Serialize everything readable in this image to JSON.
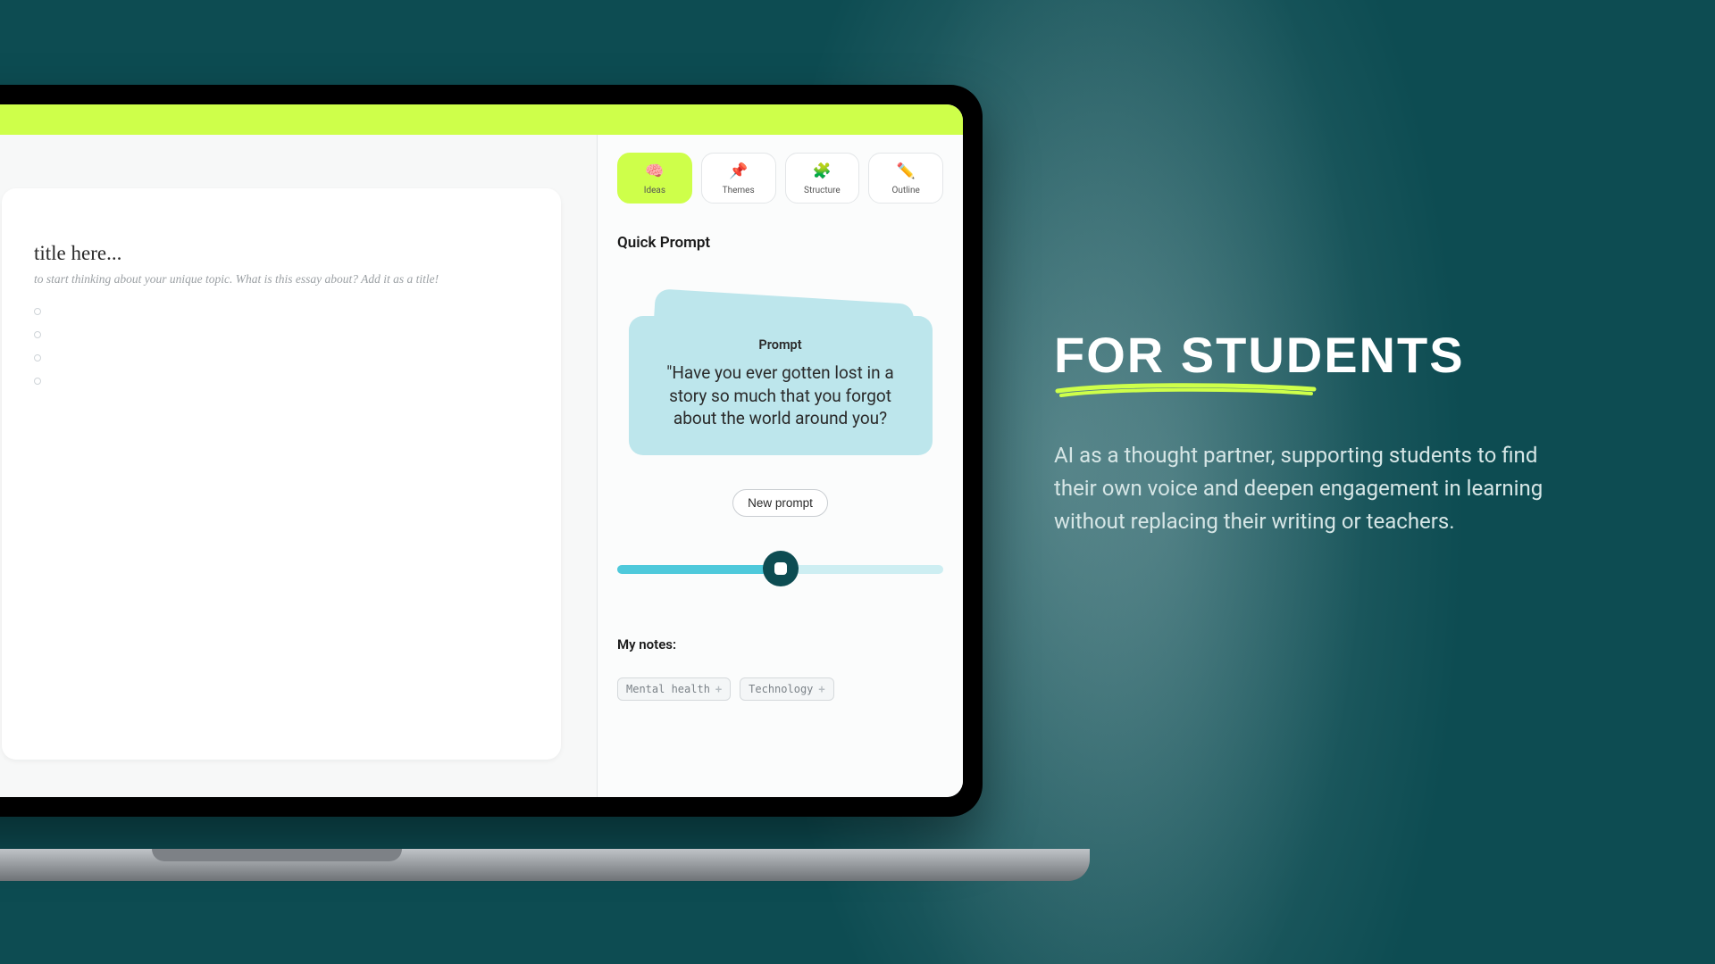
{
  "editor": {
    "title_placeholder": "title here...",
    "hint": "to start thinking about your unique topic. What is this essay about? Add it as a title!"
  },
  "tabs": [
    {
      "emoji": "🧠",
      "label": "Ideas",
      "name": "tab-ideas"
    },
    {
      "emoji": "📌",
      "label": "Themes",
      "name": "tab-themes"
    },
    {
      "emoji": "🧩",
      "label": "Structure",
      "name": "tab-structure"
    },
    {
      "emoji": "✏️",
      "label": "Outline",
      "name": "tab-outline"
    }
  ],
  "sidebar": {
    "section": "Quick Prompt",
    "prompt_label": "Prompt",
    "prompt_text": "\"Have you ever gotten lost in a story so much that you forgot about the world around you?",
    "new_prompt": "New prompt",
    "notes_label": "My notes:",
    "tags": [
      "Mental health",
      "Technology"
    ]
  },
  "marketing": {
    "title": "For Students",
    "body": "AI as a thought partner, supporting students to find their own voice and deepen engagement in learning without replacing their writing or teachers."
  }
}
